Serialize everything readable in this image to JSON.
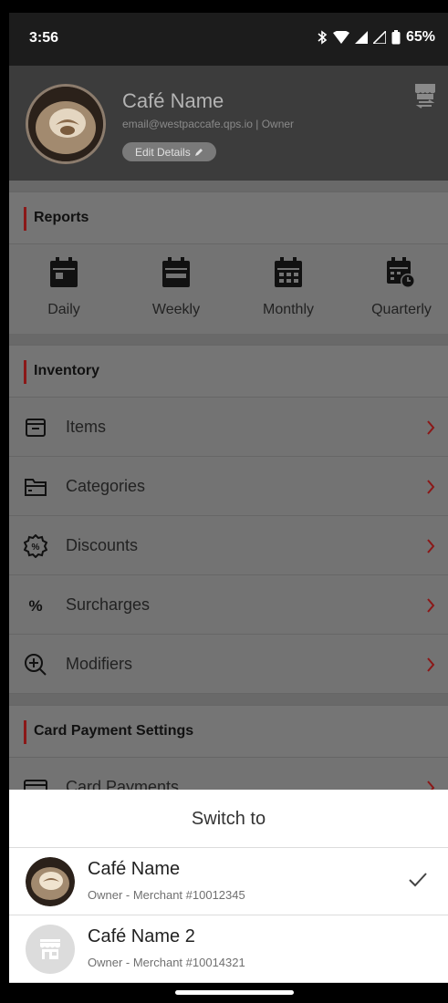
{
  "status_bar": {
    "time": "3:56",
    "battery": "65%"
  },
  "header": {
    "cafe_name": "Café Name",
    "subtitle": "email@westpaccafe.qps.io | Owner",
    "edit_label": "Edit Details"
  },
  "reports": {
    "section_title": "Reports",
    "items": [
      {
        "label": "Daily",
        "icon": "calendar-day-icon"
      },
      {
        "label": "Weekly",
        "icon": "calendar-week-icon"
      },
      {
        "label": "Monthly",
        "icon": "calendar-month-icon"
      },
      {
        "label": "Quarterly",
        "icon": "calendar-clock-icon"
      }
    ]
  },
  "inventory": {
    "section_title": "Inventory",
    "items": [
      {
        "label": "Items",
        "icon": "box-icon"
      },
      {
        "label": "Categories",
        "icon": "folder-icon"
      },
      {
        "label": "Discounts",
        "icon": "discount-badge-icon"
      },
      {
        "label": "Surcharges",
        "icon": "percent-icon"
      },
      {
        "label": "Modifiers",
        "icon": "plus-magnifier-icon"
      }
    ]
  },
  "card_payment": {
    "section_title": "Card Payment Settings",
    "items": [
      {
        "label": "Card Payments",
        "icon": "card-icon"
      }
    ]
  },
  "sheet": {
    "title": "Switch to",
    "accounts": [
      {
        "name": "Café Name",
        "subtitle": "Owner - Merchant #10012345",
        "selected": true
      },
      {
        "name": "Café Name 2",
        "subtitle": "Owner - Merchant #10014321",
        "selected": false
      }
    ]
  },
  "colors": {
    "accent_red": "#8b1818",
    "header_bg": "#3c3c3c",
    "overlay_content": "#737373"
  }
}
